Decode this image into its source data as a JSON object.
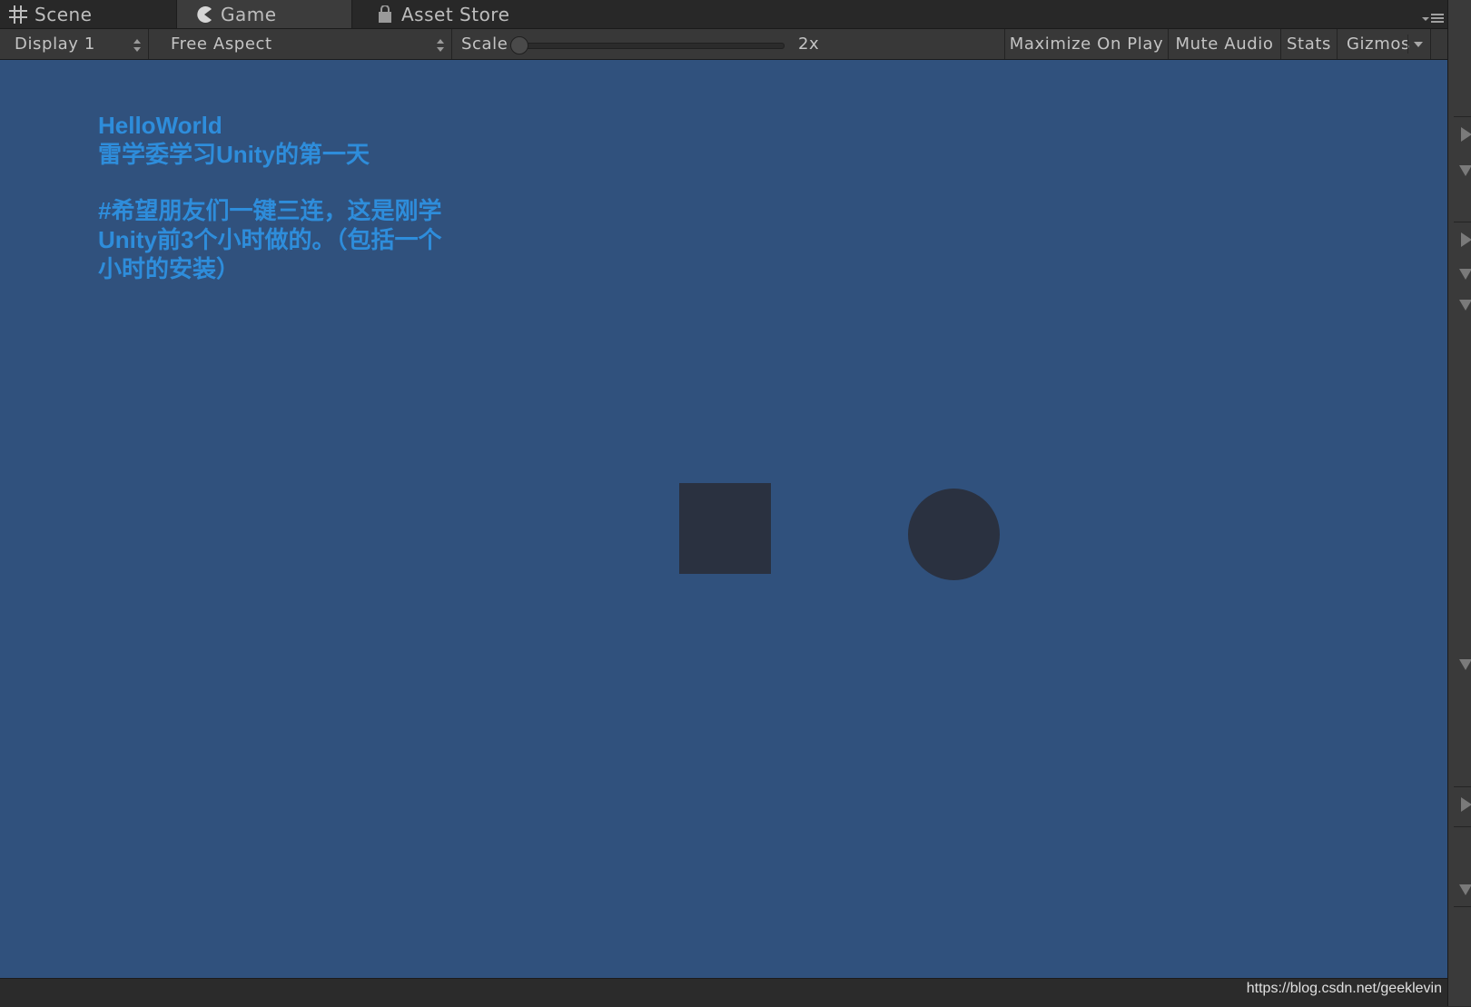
{
  "tabs": {
    "scene": "Scene",
    "game": "Game",
    "asset_store": "Asset Store"
  },
  "toolbar": {
    "display": "Display 1",
    "aspect": "Free Aspect",
    "scale_label": "Scale",
    "scale_value": "2x",
    "maximize": "Maximize On Play",
    "mute": "Mute Audio",
    "stats": "Stats",
    "gizmos": "Gizmos"
  },
  "game": {
    "text_lines": [
      "HelloWorld",
      "雷学委学习Unity的第一天",
      "#希望朋友们一键三连，这是刚学",
      "Unity前3个小时做的。（包括一个",
      "小时的安装）"
    ],
    "shapes": [
      "square",
      "circle"
    ]
  },
  "footer": {
    "watermark": "https://blog.csdn.net/geeklevin"
  },
  "colors": {
    "game_background": "#30517d",
    "ui_text": "#2e8ddb",
    "shape_fill": "#2a3140"
  },
  "icons": {
    "scene": "grid-icon",
    "game": "pacman-icon",
    "asset_store": "bag-icon",
    "tab_menu": "menu-icon"
  }
}
